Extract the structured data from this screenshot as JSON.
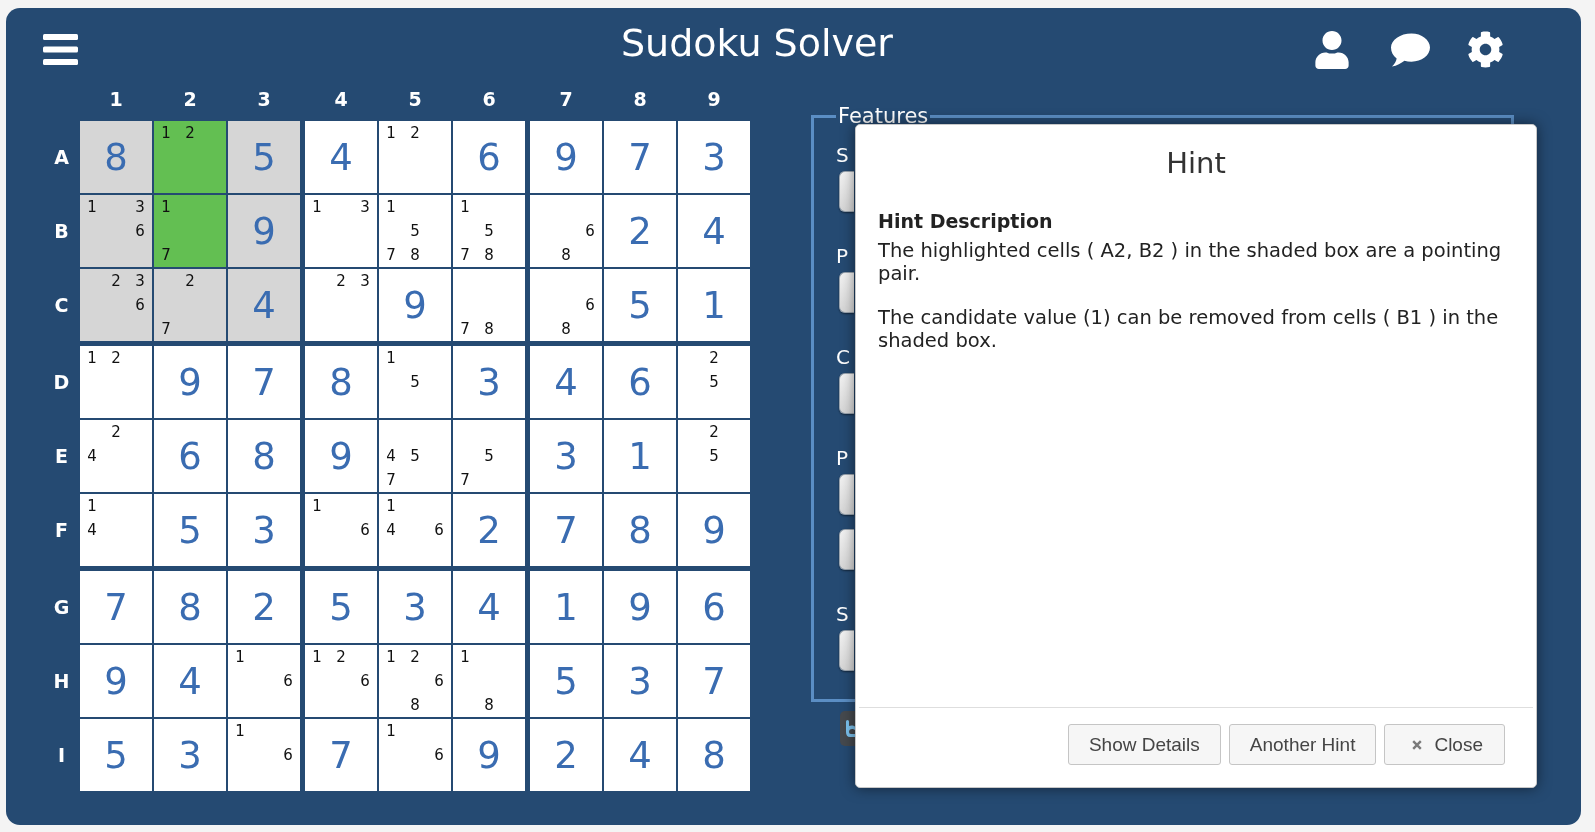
{
  "header": {
    "title": "Sudoku Solver"
  },
  "board": {
    "column_labels": [
      "1",
      "2",
      "3",
      "4",
      "5",
      "6",
      "7",
      "8",
      "9"
    ],
    "rows": [
      {
        "label": "A",
        "cells": [
          {
            "kind": "digit",
            "value": "8",
            "shaded": true,
            "highlighted": false
          },
          {
            "kind": "candidates",
            "candidates": [
              "1",
              "2"
            ],
            "shaded": false,
            "highlighted": true
          },
          {
            "kind": "digit",
            "value": "5",
            "shaded": true,
            "highlighted": false
          },
          {
            "kind": "digit",
            "value": "4",
            "shaded": false,
            "highlighted": false
          },
          {
            "kind": "candidates",
            "candidates": [
              "1",
              "2"
            ],
            "shaded": false,
            "highlighted": false
          },
          {
            "kind": "digit",
            "value": "6",
            "shaded": false,
            "highlighted": false
          },
          {
            "kind": "digit",
            "value": "9",
            "shaded": false,
            "highlighted": false
          },
          {
            "kind": "digit",
            "value": "7",
            "shaded": false,
            "highlighted": false
          },
          {
            "kind": "digit",
            "value": "3",
            "shaded": false,
            "highlighted": false
          }
        ]
      },
      {
        "label": "B",
        "cells": [
          {
            "kind": "candidates",
            "candidates": [
              "1",
              "3",
              "6"
            ],
            "shaded": true,
            "highlighted": false
          },
          {
            "kind": "candidates",
            "candidates": [
              "1",
              "7"
            ],
            "shaded": false,
            "highlighted": true
          },
          {
            "kind": "digit",
            "value": "9",
            "shaded": true,
            "highlighted": false
          },
          {
            "kind": "candidates",
            "candidates": [
              "1",
              "3"
            ],
            "shaded": false,
            "highlighted": false
          },
          {
            "kind": "candidates",
            "candidates": [
              "1",
              "5",
              "7",
              "8"
            ],
            "shaded": false,
            "highlighted": false
          },
          {
            "kind": "candidates",
            "candidates": [
              "1",
              "5",
              "7",
              "8"
            ],
            "shaded": false,
            "highlighted": false
          },
          {
            "kind": "candidates",
            "candidates": [
              "6",
              "8"
            ],
            "shaded": false,
            "highlighted": false
          },
          {
            "kind": "digit",
            "value": "2",
            "shaded": false,
            "highlighted": false
          },
          {
            "kind": "digit",
            "value": "4",
            "shaded": false,
            "highlighted": false
          }
        ]
      },
      {
        "label": "C",
        "cells": [
          {
            "kind": "candidates",
            "candidates": [
              "2",
              "3",
              "6"
            ],
            "shaded": true,
            "highlighted": false
          },
          {
            "kind": "candidates",
            "candidates": [
              "2",
              "7"
            ],
            "shaded": true,
            "highlighted": false
          },
          {
            "kind": "digit",
            "value": "4",
            "shaded": true,
            "highlighted": false
          },
          {
            "kind": "candidates",
            "candidates": [
              "2",
              "3"
            ],
            "shaded": false,
            "highlighted": false
          },
          {
            "kind": "digit",
            "value": "9",
            "shaded": false,
            "highlighted": false
          },
          {
            "kind": "candidates",
            "candidates": [
              "7",
              "8"
            ],
            "shaded": false,
            "highlighted": false
          },
          {
            "kind": "candidates",
            "candidates": [
              "6",
              "8"
            ],
            "shaded": false,
            "highlighted": false
          },
          {
            "kind": "digit",
            "value": "5",
            "shaded": false,
            "highlighted": false
          },
          {
            "kind": "digit",
            "value": "1",
            "shaded": false,
            "highlighted": false
          }
        ]
      },
      {
        "label": "D",
        "cells": [
          {
            "kind": "candidates",
            "candidates": [
              "1",
              "2"
            ],
            "shaded": false,
            "highlighted": false
          },
          {
            "kind": "digit",
            "value": "9",
            "shaded": false,
            "highlighted": false
          },
          {
            "kind": "digit",
            "value": "7",
            "shaded": false,
            "highlighted": false
          },
          {
            "kind": "digit",
            "value": "8",
            "shaded": false,
            "highlighted": false
          },
          {
            "kind": "candidates",
            "candidates": [
              "1",
              "5"
            ],
            "shaded": false,
            "highlighted": false
          },
          {
            "kind": "digit",
            "value": "3",
            "shaded": false,
            "highlighted": false
          },
          {
            "kind": "digit",
            "value": "4",
            "shaded": false,
            "highlighted": false
          },
          {
            "kind": "digit",
            "value": "6",
            "shaded": false,
            "highlighted": false
          },
          {
            "kind": "candidates",
            "candidates": [
              "2",
              "5"
            ],
            "shaded": false,
            "highlighted": false
          }
        ]
      },
      {
        "label": "E",
        "cells": [
          {
            "kind": "candidates",
            "candidates": [
              "2",
              "4"
            ],
            "shaded": false,
            "highlighted": false
          },
          {
            "kind": "digit",
            "value": "6",
            "shaded": false,
            "highlighted": false
          },
          {
            "kind": "digit",
            "value": "8",
            "shaded": false,
            "highlighted": false
          },
          {
            "kind": "digit",
            "value": "9",
            "shaded": false,
            "highlighted": false
          },
          {
            "kind": "candidates",
            "candidates": [
              "4",
              "5",
              "7"
            ],
            "shaded": false,
            "highlighted": false
          },
          {
            "kind": "candidates",
            "candidates": [
              "5",
              "7"
            ],
            "shaded": false,
            "highlighted": false
          },
          {
            "kind": "digit",
            "value": "3",
            "shaded": false,
            "highlighted": false
          },
          {
            "kind": "digit",
            "value": "1",
            "shaded": false,
            "highlighted": false
          },
          {
            "kind": "candidates",
            "candidates": [
              "2",
              "5"
            ],
            "shaded": false,
            "highlighted": false
          }
        ]
      },
      {
        "label": "F",
        "cells": [
          {
            "kind": "candidates",
            "candidates": [
              "1",
              "4"
            ],
            "shaded": false,
            "highlighted": false
          },
          {
            "kind": "digit",
            "value": "5",
            "shaded": false,
            "highlighted": false
          },
          {
            "kind": "digit",
            "value": "3",
            "shaded": false,
            "highlighted": false
          },
          {
            "kind": "candidates",
            "candidates": [
              "1",
              "6"
            ],
            "shaded": false,
            "highlighted": false
          },
          {
            "kind": "candidates",
            "candidates": [
              "1",
              "4",
              "6"
            ],
            "shaded": false,
            "highlighted": false
          },
          {
            "kind": "digit",
            "value": "2",
            "shaded": false,
            "highlighted": false
          },
          {
            "kind": "digit",
            "value": "7",
            "shaded": false,
            "highlighted": false
          },
          {
            "kind": "digit",
            "value": "8",
            "shaded": false,
            "highlighted": false
          },
          {
            "kind": "digit",
            "value": "9",
            "shaded": false,
            "highlighted": false
          }
        ]
      },
      {
        "label": "G",
        "cells": [
          {
            "kind": "digit",
            "value": "7",
            "shaded": false,
            "highlighted": false
          },
          {
            "kind": "digit",
            "value": "8",
            "shaded": false,
            "highlighted": false
          },
          {
            "kind": "digit",
            "value": "2",
            "shaded": false,
            "highlighted": false
          },
          {
            "kind": "digit",
            "value": "5",
            "shaded": false,
            "highlighted": false
          },
          {
            "kind": "digit",
            "value": "3",
            "shaded": false,
            "highlighted": false
          },
          {
            "kind": "digit",
            "value": "4",
            "shaded": false,
            "highlighted": false
          },
          {
            "kind": "digit",
            "value": "1",
            "shaded": false,
            "highlighted": false
          },
          {
            "kind": "digit",
            "value": "9",
            "shaded": false,
            "highlighted": false
          },
          {
            "kind": "digit",
            "value": "6",
            "shaded": false,
            "highlighted": false
          }
        ]
      },
      {
        "label": "H",
        "cells": [
          {
            "kind": "digit",
            "value": "9",
            "shaded": false,
            "highlighted": false
          },
          {
            "kind": "digit",
            "value": "4",
            "shaded": false,
            "highlighted": false
          },
          {
            "kind": "candidates",
            "candidates": [
              "1",
              "6"
            ],
            "shaded": false,
            "highlighted": false
          },
          {
            "kind": "candidates",
            "candidates": [
              "1",
              "2",
              "6"
            ],
            "shaded": false,
            "highlighted": false
          },
          {
            "kind": "candidates",
            "candidates": [
              "1",
              "2",
              "6",
              "8"
            ],
            "shaded": false,
            "highlighted": false
          },
          {
            "kind": "candidates",
            "candidates": [
              "1",
              "8"
            ],
            "shaded": false,
            "highlighted": false
          },
          {
            "kind": "digit",
            "value": "5",
            "shaded": false,
            "highlighted": false
          },
          {
            "kind": "digit",
            "value": "3",
            "shaded": false,
            "highlighted": false
          },
          {
            "kind": "digit",
            "value": "7",
            "shaded": false,
            "highlighted": false
          }
        ]
      },
      {
        "label": "I",
        "cells": [
          {
            "kind": "digit",
            "value": "5",
            "shaded": false,
            "highlighted": false
          },
          {
            "kind": "digit",
            "value": "3",
            "shaded": false,
            "highlighted": false
          },
          {
            "kind": "candidates",
            "candidates": [
              "1",
              "6"
            ],
            "shaded": false,
            "highlighted": false
          },
          {
            "kind": "digit",
            "value": "7",
            "shaded": false,
            "highlighted": false
          },
          {
            "kind": "candidates",
            "candidates": [
              "1",
              "6"
            ],
            "shaded": false,
            "highlighted": false
          },
          {
            "kind": "digit",
            "value": "9",
            "shaded": false,
            "highlighted": false
          },
          {
            "kind": "digit",
            "value": "2",
            "shaded": false,
            "highlighted": false
          },
          {
            "kind": "digit",
            "value": "4",
            "shaded": false,
            "highlighted": false
          },
          {
            "kind": "digit",
            "value": "8",
            "shaded": false,
            "highlighted": false
          }
        ]
      }
    ]
  },
  "features": {
    "legend": "Features",
    "groups": [
      {
        "label": "S",
        "controls": [
          {
            "kind": "button"
          }
        ]
      },
      {
        "label": "P",
        "controls": [
          {
            "kind": "button"
          }
        ]
      },
      {
        "label": "C",
        "controls": [
          {
            "kind": "button"
          }
        ]
      },
      {
        "label": "P",
        "controls": [
          {
            "kind": "button"
          },
          {
            "kind": "button"
          }
        ]
      },
      {
        "label": "S",
        "controls": [
          {
            "kind": "button"
          }
        ]
      }
    ],
    "below": [
      {
        "kind": "dark-button"
      }
    ]
  },
  "dialog": {
    "title": "Hint",
    "heading": "Hint Description",
    "paragraphs": [
      "The highlighted cells ( A2, B2 ) in the shaded box are a pointing pair.",
      "The candidate value (1) can be removed from cells ( B1 ) in the shaded box."
    ],
    "buttons": [
      {
        "kind": "plain",
        "label": "Show Details"
      },
      {
        "kind": "plain",
        "label": "Another Hint"
      },
      {
        "kind": "close",
        "label": "Close"
      }
    ]
  }
}
